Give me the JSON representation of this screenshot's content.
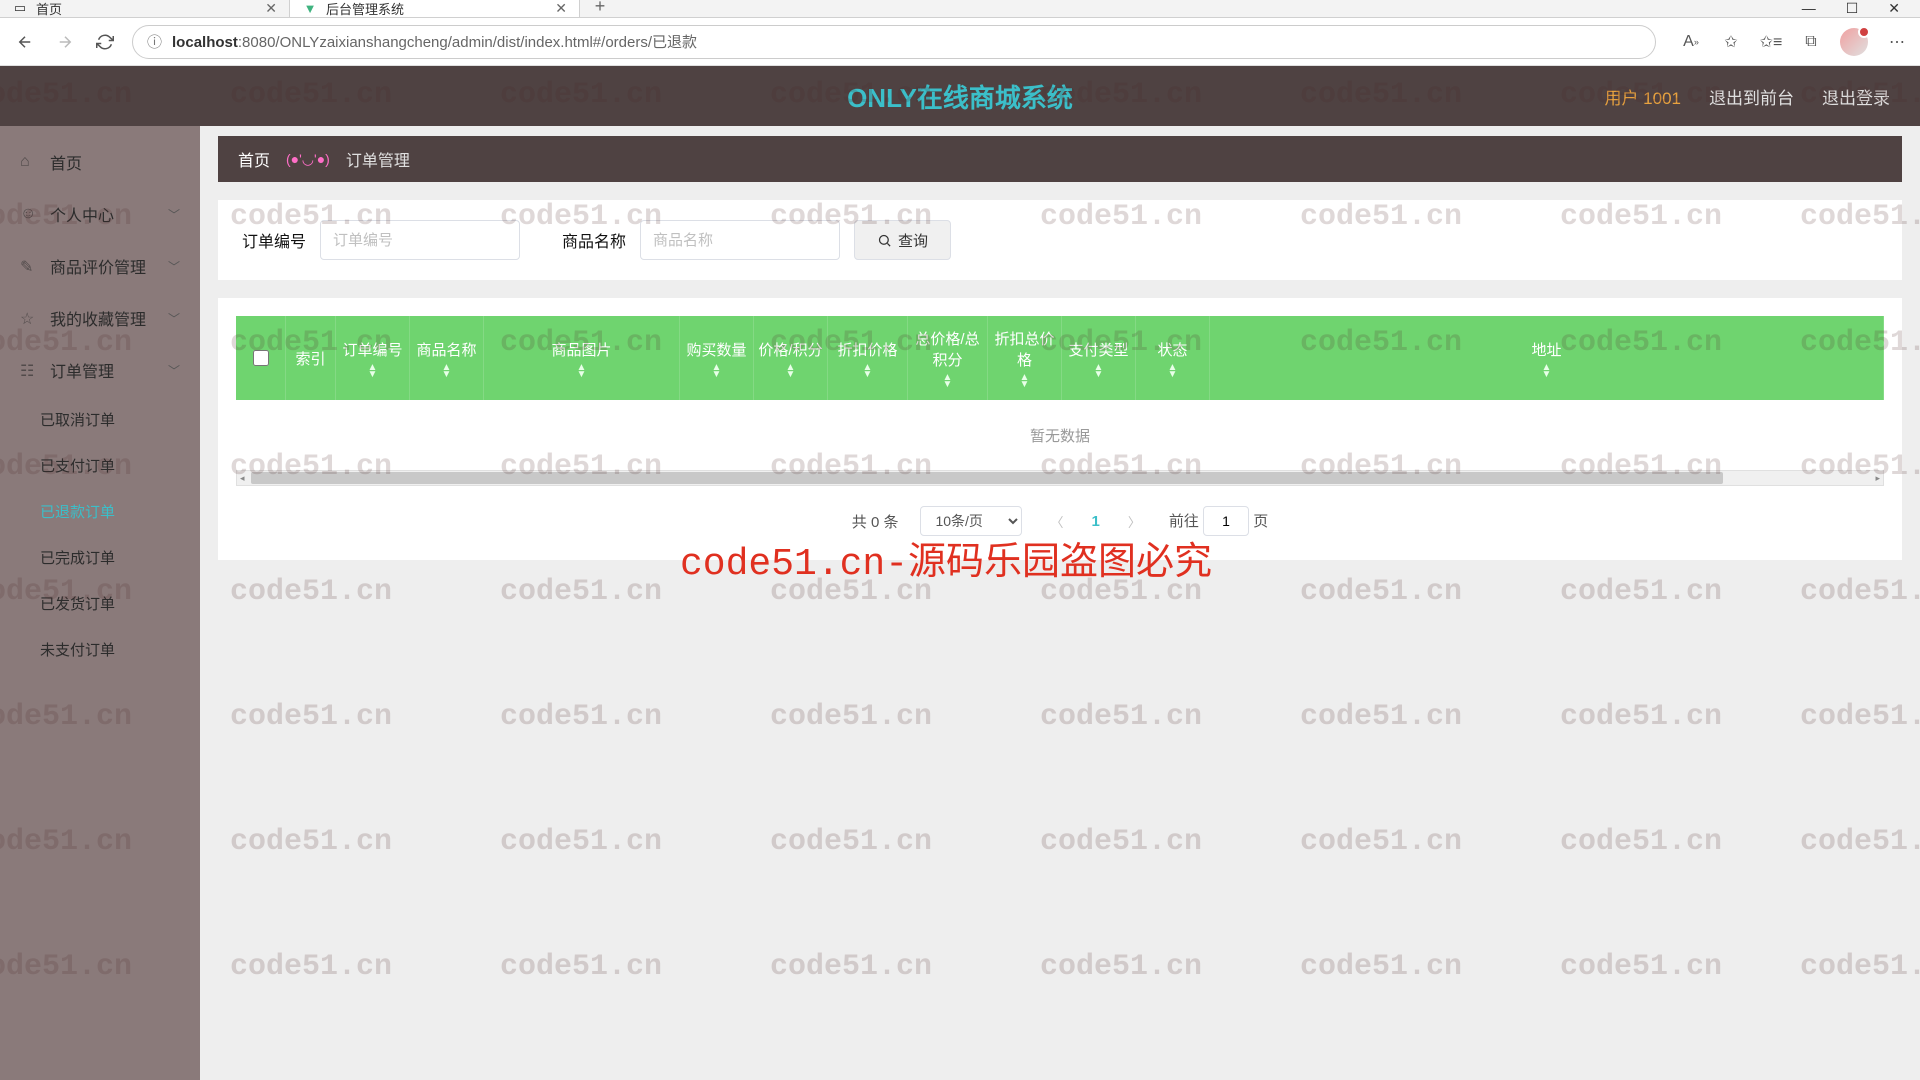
{
  "browser": {
    "tabs": [
      {
        "title": "首页"
      },
      {
        "title": "后台管理系统"
      }
    ],
    "url": "localhost:8080/ONLYzaixianshangcheng/admin/dist/index.html#/orders/已退款",
    "url_host": "localhost",
    "url_rest": ":8080/ONLYzaixianshangcheng/admin/dist/index.html#/orders/已退款"
  },
  "header": {
    "title": "ONLY在线商城系统",
    "user": "用户 1001",
    "to_front": "退出到前台",
    "logout": "退出登录"
  },
  "sidebar": {
    "items": [
      {
        "label": "首页",
        "expandable": false
      },
      {
        "label": "个人中心",
        "expandable": true
      },
      {
        "label": "商品评价管理",
        "expandable": true
      },
      {
        "label": "我的收藏管理",
        "expandable": true
      },
      {
        "label": "订单管理",
        "expandable": true
      }
    ],
    "subitems": [
      {
        "label": "已取消订单"
      },
      {
        "label": "已支付订单"
      },
      {
        "label": "已退款订单",
        "active": true
      },
      {
        "label": "已完成订单"
      },
      {
        "label": "已发货订单"
      },
      {
        "label": "未支付订单"
      }
    ]
  },
  "breadcrumb": {
    "home": "首页",
    "emoji": "(●'◡'●)",
    "current": "订单管理"
  },
  "search": {
    "label_order": "订单编号",
    "placeholder_order": "订单编号",
    "label_product": "商品名称",
    "placeholder_product": "商品名称",
    "query_btn": "查询"
  },
  "table": {
    "columns": [
      "索引",
      "订单编号",
      "商品名称",
      "商品图片",
      "购买数量",
      "价格/积分",
      "折扣价格",
      "总价格/总积分",
      "折扣总价格",
      "支付类型",
      "状态",
      "地址"
    ],
    "no_data": "暂无数据"
  },
  "pager": {
    "total": "共 0 条",
    "page_size": "10条/页",
    "current": "1",
    "goto_prefix": "前往",
    "goto_val": "1",
    "goto_suffix": "页"
  },
  "watermark": {
    "text": "code51.cn",
    "red": "code51.cn-源码乐园盗图必究"
  }
}
